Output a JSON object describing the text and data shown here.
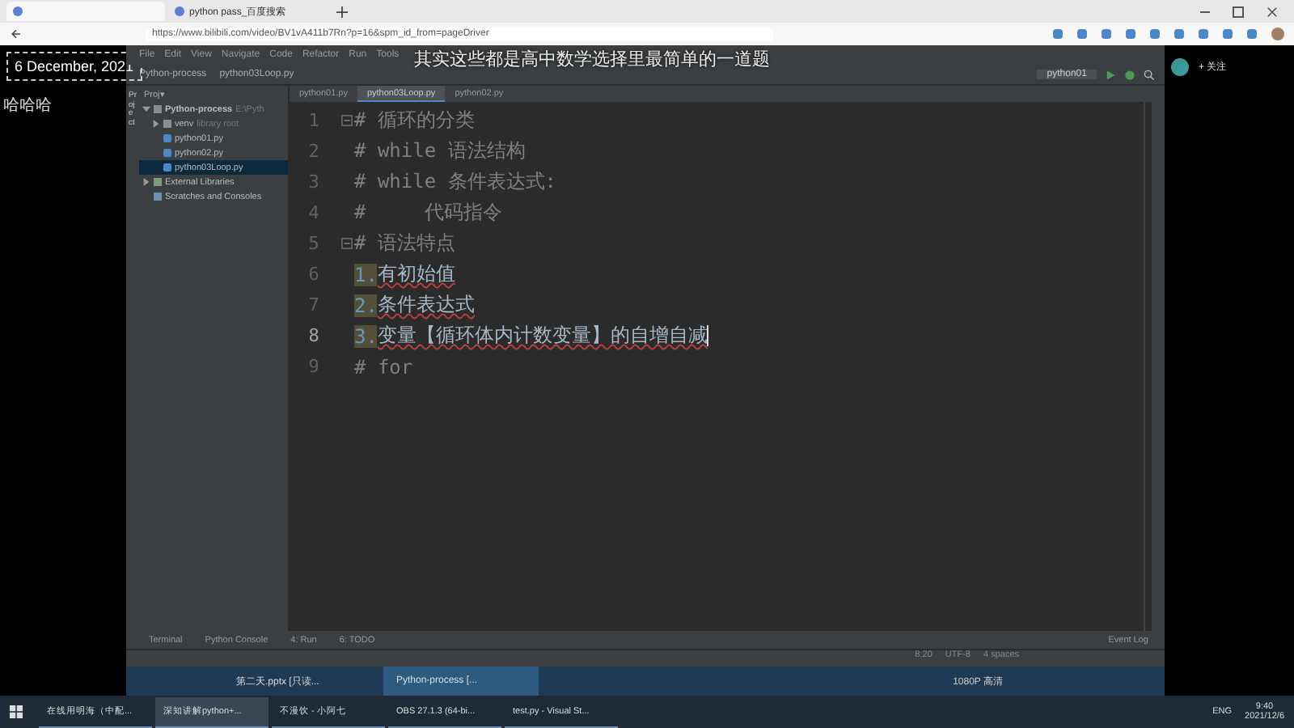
{
  "browser": {
    "tabs": [
      {
        "selected": true
      },
      {
        "label": "python pass_百度搜索",
        "selected": false
      }
    ],
    "address": "https://www.bilibili.com/video/BV1vA411b7Rn?p=16&spm_id_from=pageDriver"
  },
  "overlay": {
    "date": "6 December, 2021",
    "side_text": "哈哈哈",
    "subtitle": "其实这些都是高中数学选择里最简单的一道题"
  },
  "ide": {
    "menu": [
      "File",
      "Edit",
      "View",
      "Navigate",
      "Code",
      "Refactor",
      "Run",
      "Tools"
    ],
    "breadcrumb": [
      "Python-process",
      "python03Loop.py"
    ],
    "run_config": "python01",
    "project_label": "Project",
    "project_menu": "Proj▾",
    "tree": [
      {
        "label": "Python-process",
        "note": "E:\\Pyth",
        "kind": "project",
        "expanded": true,
        "selected": false,
        "children": [
          {
            "label": "venv",
            "note": "library root",
            "kind": "folder",
            "expanded": false,
            "selected": false
          },
          {
            "label": "python01.py",
            "kind": "file",
            "selected": false
          },
          {
            "label": "python02.py",
            "kind": "file",
            "selected": false
          },
          {
            "label": "python03Loop.py",
            "kind": "file",
            "selected": true
          }
        ]
      },
      {
        "label": "External Libraries",
        "kind": "library",
        "expanded": false,
        "selected": false
      },
      {
        "label": "Scratches and Consoles",
        "kind": "scratch",
        "selected": false
      }
    ],
    "editor_tabs": [
      {
        "label": "python01.py",
        "selected": false
      },
      {
        "label": "python03Loop.py",
        "selected": true
      },
      {
        "label": "python02.py",
        "selected": false
      }
    ],
    "lines": [
      {
        "number": "1",
        "kind": "comment",
        "text": "# 循环的分类",
        "fold": true,
        "current": false
      },
      {
        "number": "2",
        "kind": "comment",
        "text": "# while 语法结构",
        "fold": false,
        "current": false
      },
      {
        "number": "3",
        "kind": "comment",
        "text": "# while 条件表达式:",
        "fold": false,
        "current": false
      },
      {
        "number": "4",
        "kind": "comment",
        "text": "#     代码指令",
        "fold": false,
        "current": false
      },
      {
        "number": "5",
        "kind": "comment",
        "text": "# 语法特点",
        "fold": true,
        "current": false
      },
      {
        "number": "6",
        "kind": "item",
        "marker": "1.",
        "text": "有初始值",
        "fold": false,
        "current": false
      },
      {
        "number": "7",
        "kind": "item",
        "marker": "2.",
        "text": "条件表达式",
        "fold": false,
        "current": false
      },
      {
        "number": "8",
        "kind": "item",
        "marker": "3.",
        "text": "变量【循环体内计数变量】的自增自减",
        "fold": false,
        "current": true
      },
      {
        "number": "9",
        "kind": "comment",
        "text": "# for",
        "fold": false,
        "current": false
      }
    ],
    "tool_tabs": [
      "Terminal",
      "Python Console",
      "4: Run",
      "6: TODO"
    ],
    "event_log": "Event Log",
    "status": [
      "8:20",
      "UTF-8",
      "4 spaces"
    ]
  },
  "player": {
    "taskbar": [
      {
        "label": "第二天.pptx [只读...",
        "selected": false
      },
      {
        "label": "Python-process [...",
        "selected": true
      }
    ],
    "quality": "1080P 高清",
    "follow": "+ 关注"
  },
  "taskbar": {
    "apps": [
      {
        "label": "在线用明海（中配...",
        "selected": false
      },
      {
        "label": "深知讲解python+...",
        "selected": true
      },
      {
        "label": "不漫饮 - 小阿七",
        "selected": false
      },
      {
        "label": "OBS 27.1.3 (64-bi...",
        "selected": false
      },
      {
        "label": "test.py - Visual St...",
        "selected": false
      }
    ],
    "language": "ENG",
    "time": "9:40",
    "date": "2021/12/6"
  }
}
